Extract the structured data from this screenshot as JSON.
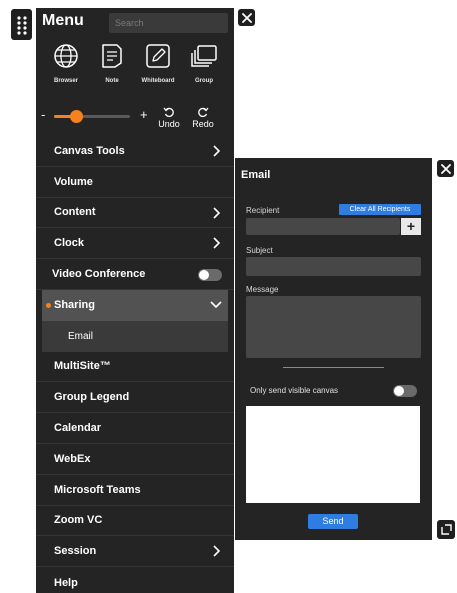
{
  "menu": {
    "title": "Menu",
    "search_placeholder": "Search",
    "tools": [
      {
        "label": "Browser",
        "icon": "globe-icon"
      },
      {
        "label": "Note",
        "icon": "note-icon"
      },
      {
        "label": "Whiteboard",
        "icon": "whiteboard-icon"
      },
      {
        "label": "Group",
        "icon": "group-icon"
      }
    ],
    "slider": {
      "minus": "-",
      "plus": "+",
      "value_fraction": 0.3
    },
    "undo_label": "Undo",
    "redo_label": "Redo",
    "items": [
      {
        "label": "Canvas Tools"
      },
      {
        "label": "Volume"
      },
      {
        "label": "Content"
      },
      {
        "label": "Clock"
      },
      {
        "label": "Video Conference"
      },
      {
        "label": "Sharing"
      },
      {
        "label": "Email"
      },
      {
        "label": "MultiSite™"
      },
      {
        "label": "Group Legend"
      },
      {
        "label": "Calendar"
      },
      {
        "label": "WebEx"
      },
      {
        "label": "Microsoft Teams"
      },
      {
        "label": "Zoom VC"
      },
      {
        "label": "Session"
      },
      {
        "label": "Help"
      }
    ]
  },
  "email": {
    "title": "Email",
    "recipient_label": "Recipient",
    "clear_all_label": "Clear All Recipients",
    "add_label": "+",
    "subject_label": "Subject",
    "message_label": "Message",
    "visible_label": "Only send visible canvas",
    "send_label": "Send"
  },
  "colors": {
    "accent": "#f5821f",
    "blue": "#2f7de1",
    "panel": "#242424"
  }
}
